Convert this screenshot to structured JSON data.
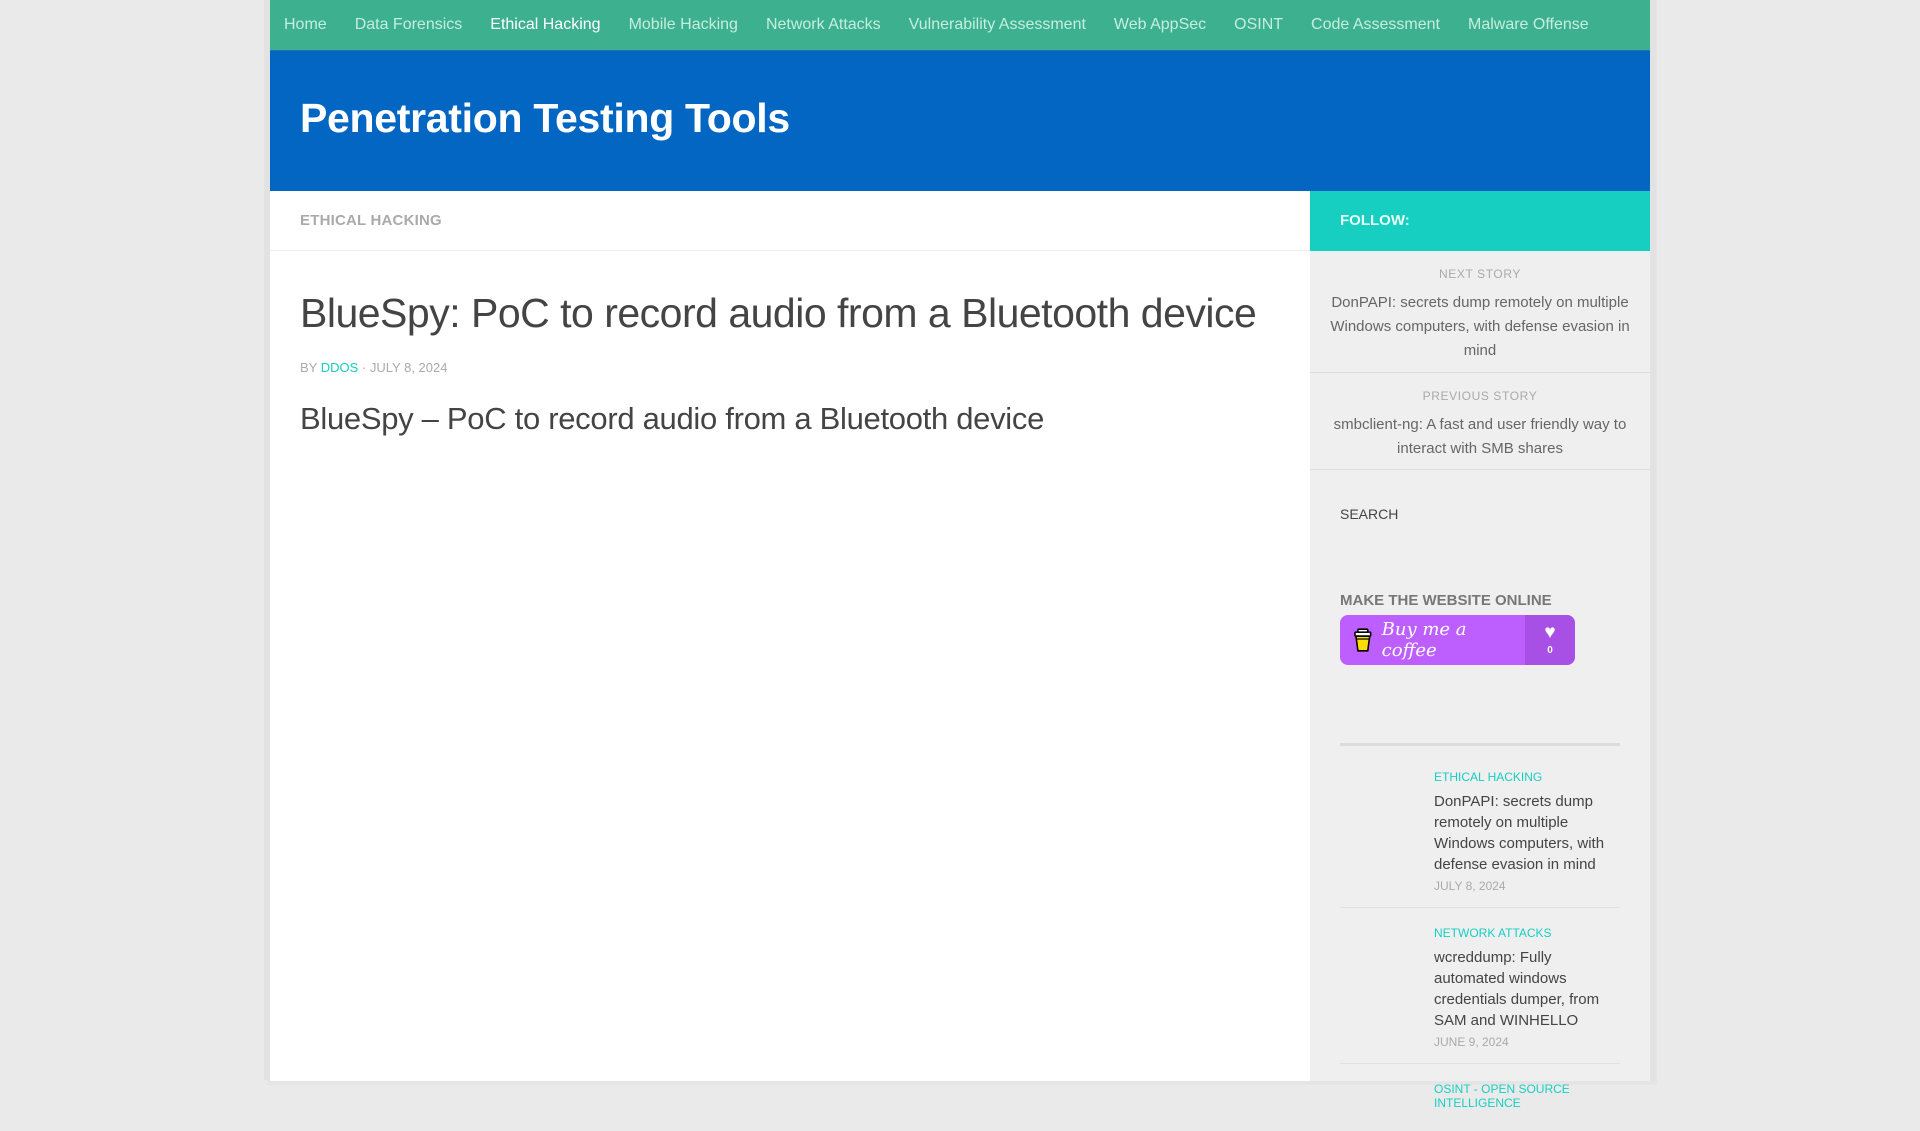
{
  "nav": {
    "items": [
      {
        "label": "Home",
        "active": false
      },
      {
        "label": "Data Forensics",
        "active": false
      },
      {
        "label": "Ethical Hacking",
        "active": true
      },
      {
        "label": "Mobile Hacking",
        "active": false
      },
      {
        "label": "Network Attacks",
        "active": false
      },
      {
        "label": "Vulnerability Assessment",
        "active": false
      },
      {
        "label": "Web AppSec",
        "active": false
      },
      {
        "label": "OSINT",
        "active": false
      },
      {
        "label": "Code Assessment",
        "active": false
      },
      {
        "label": "Malware Offense",
        "active": false
      }
    ]
  },
  "header": {
    "site_title": "Penetration Testing Tools"
  },
  "main": {
    "category": "ETHICAL HACKING",
    "post_title": "BlueSpy: PoC to record audio from a Bluetooth device",
    "byline_prefix": "BY",
    "author": "DDOS",
    "separator": "·",
    "date": "JULY 8, 2024",
    "subtitle": "BlueSpy – PoC to record audio from a Bluetooth device"
  },
  "sidebar": {
    "follow_label": "FOLLOW:",
    "next_story": {
      "label": "NEXT STORY",
      "title": "DonPAPI: secrets dump remotely on multiple Windows computers, with defense evasion in mind"
    },
    "previous_story": {
      "label": "PREVIOUS STORY",
      "title": "smbclient-ng: A fast and user friendly way to interact with SMB shares"
    },
    "search_label": "SEARCH",
    "support_title": "MAKE THE WEBSITE ONLINE",
    "coffee_button": {
      "label": "Buy me a coffee",
      "count": "0",
      "icon": "coffee-cup-icon",
      "heart_icon": "heart-icon",
      "color": "#bd5fff"
    },
    "recent_posts": [
      {
        "category": "ETHICAL HACKING",
        "title": "DonPAPI: secrets dump remotely on multiple Windows computers, with defense evasion in mind",
        "date": "JULY 8, 2024"
      },
      {
        "category": "NETWORK ATTACKS",
        "title": "wcreddump: Fully automated windows credentials dumper, from SAM and WINHELLO",
        "date": "JUNE 9, 2024"
      },
      {
        "category": "OSINT - OPEN SOURCE INTELLIGENCE",
        "title": "",
        "date": ""
      }
    ]
  },
  "colors": {
    "nav_bg": "#3db08f",
    "header_bg": "#0266c2",
    "accent": "#16cfc1",
    "sidebar_bg": "#efefef",
    "page_bg": "#eaeaea"
  }
}
